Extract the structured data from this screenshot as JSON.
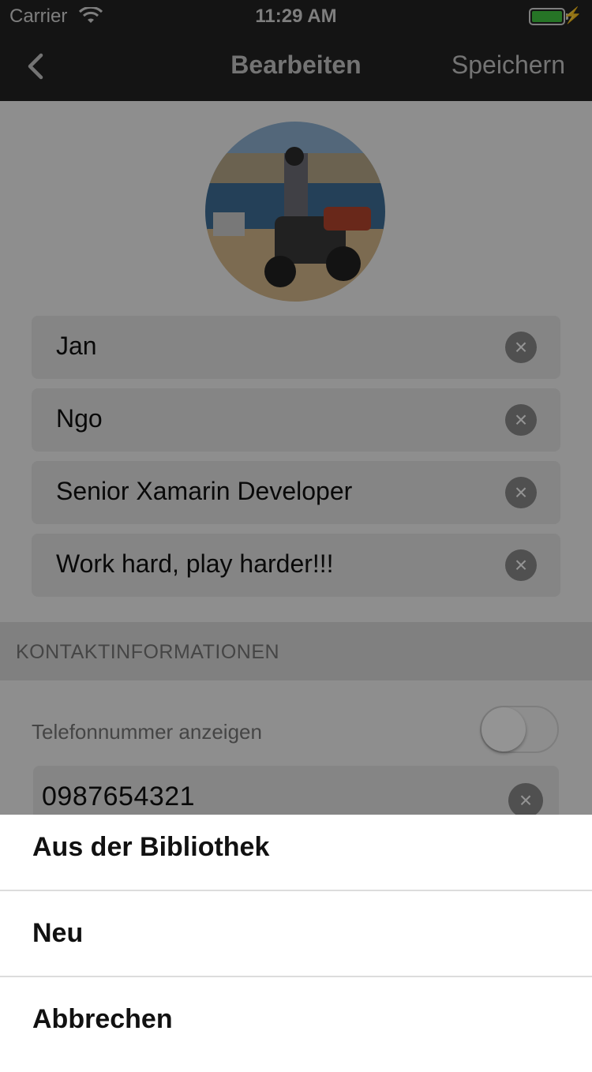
{
  "status_bar": {
    "carrier": "Carrier",
    "time": "11:29 AM"
  },
  "nav": {
    "title": "Bearbeiten",
    "save_label": "Speichern"
  },
  "profile": {
    "fields": [
      {
        "value": "Jan"
      },
      {
        "value": "Ngo"
      },
      {
        "value": "Senior Xamarin Developer"
      },
      {
        "value": "Work hard, play harder!!!"
      }
    ]
  },
  "contact": {
    "section_title": "KONTAKTINFORMATIONEN",
    "show_phone_label": "Telefonnummer anzeigen",
    "show_phone_on": false,
    "phone": "0987654321"
  },
  "action_sheet": {
    "items": [
      {
        "label": "Aus der Bibliothek"
      },
      {
        "label": "Neu"
      },
      {
        "label": "Abbrechen"
      }
    ]
  },
  "colors": {
    "battery": "#43c843",
    "nav_bg": "#232323"
  },
  "icons": {
    "back": "chevron-left-icon",
    "clear": "clear-icon",
    "wifi": "wifi-icon",
    "battery": "battery-icon",
    "charging": "bolt-icon"
  }
}
